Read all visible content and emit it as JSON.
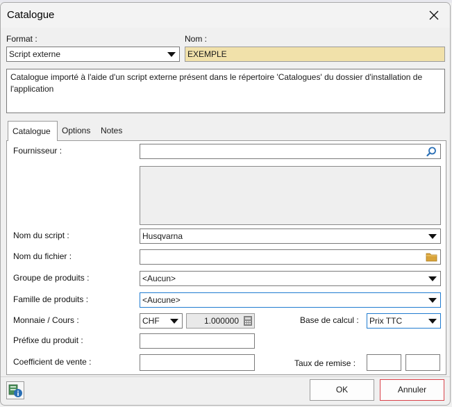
{
  "dialog": {
    "title": "Catalogue"
  },
  "format": {
    "label": "Format :",
    "value": "Script externe"
  },
  "name": {
    "label": "Nom :",
    "value": "EXEMPLE"
  },
  "description": "Catalogue importé à l'aide d'un script externe présent dans le répertoire 'Catalogues' du dossier d'installation de l'application",
  "tabs": [
    {
      "label": "Catalogue"
    },
    {
      "label": "Options"
    },
    {
      "label": "Notes"
    }
  ],
  "form": {
    "supplier_label": "Fournisseur :",
    "supplier_value": "",
    "script_label": "Nom du script :",
    "script_value": "Husqvarna",
    "file_label": "Nom du fichier :",
    "file_value": "",
    "group_label": "Groupe de produits :",
    "group_value": "<Aucun>",
    "family_label": "Famille  de produits :",
    "family_value": "<Aucune>",
    "currency_label": "Monnaie / Cours :",
    "currency_value": "CHF",
    "rate_value": "1.000000",
    "calc_base_label": "Base de calcul :",
    "calc_base_value": "Prix TTC",
    "prefix_label": "Préfixe du produit :",
    "prefix_value": "",
    "coef_label": "Coefficient  de vente :",
    "coef_value": "",
    "discount_label": "Taux de remise :"
  },
  "buttons": {
    "ok": "OK",
    "cancel": "Annuler"
  },
  "icons": {
    "close": "close-icon",
    "search": "search-icon",
    "folder": "folder-icon",
    "calculator": "calculator-icon",
    "info": "info-icon"
  },
  "colors": {
    "name_field_bg": "#f1e1aa",
    "focus_border": "#1f7bd0",
    "cancel_border": "#d9424a"
  }
}
